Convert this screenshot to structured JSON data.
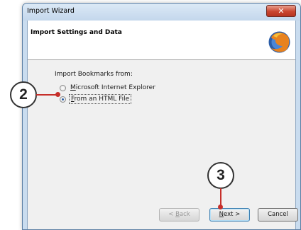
{
  "window": {
    "title": "Import Wizard",
    "close_glyph": "✕"
  },
  "header": {
    "title": "Import Settings and Data",
    "logo_icon": "firefox-logo"
  },
  "import": {
    "group_label": "Import Bookmarks from:",
    "options": [
      {
        "pre": "",
        "accel": "M",
        "post": "icrosoft Internet Explorer",
        "selected": false
      },
      {
        "pre": "",
        "accel": "F",
        "post": "rom an HTML File",
        "selected": true
      }
    ]
  },
  "buttons": {
    "back": {
      "pre": "< ",
      "accel": "B",
      "post": "ack"
    },
    "next": {
      "pre": "",
      "accel": "N",
      "post": "ext >"
    },
    "cancel": "Cancel"
  },
  "callouts": {
    "step2": "2",
    "step3": "3"
  },
  "colors": {
    "callout_line": "#c62f2a"
  }
}
